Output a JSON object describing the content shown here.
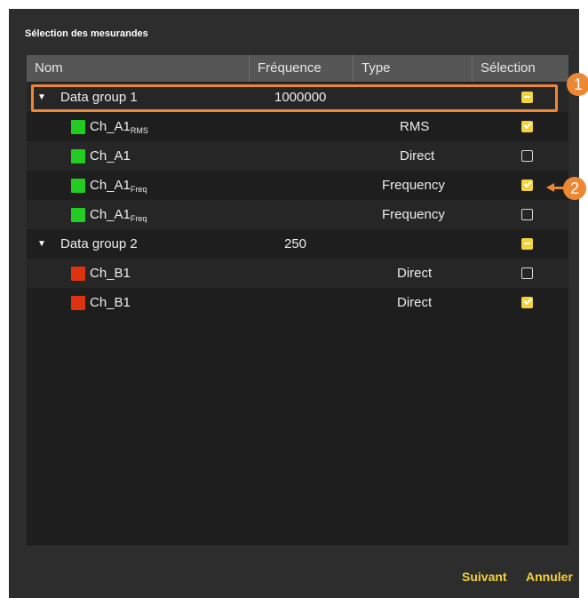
{
  "dialog": {
    "title": "Sélection des mesurandes"
  },
  "table": {
    "headers": {
      "name": "Nom",
      "frequency": "Fréquence",
      "type": "Type",
      "selection": "Sélection"
    },
    "groups": [
      {
        "name": "Data group 1",
        "frequency": "1000000",
        "selection": "partial",
        "channels": [
          {
            "base": "Ch_A1",
            "sub": "RMS",
            "type": "RMS",
            "color": "#22cc22",
            "selected": true
          },
          {
            "base": "Ch_A1",
            "sub": "",
            "type": "Direct",
            "color": "#22cc22",
            "selected": false
          },
          {
            "base": "Ch_A1",
            "sub": "Freq",
            "type": "Frequency",
            "color": "#22cc22",
            "selected": true
          },
          {
            "base": "Ch_A1",
            "sub": "Freq",
            "type": "Frequency",
            "color": "#22cc22",
            "selected": false
          }
        ]
      },
      {
        "name": "Data group 2",
        "frequency": "250",
        "selection": "partial",
        "channels": [
          {
            "base": "Ch_B1",
            "sub": "",
            "type": "Direct",
            "color": "#dd3311",
            "selected": false
          },
          {
            "base": "Ch_B1",
            "sub": "",
            "type": "Direct",
            "color": "#dd3311",
            "selected": true
          }
        ]
      }
    ]
  },
  "callouts": {
    "one": "1",
    "two": "2",
    "color": "#ee8733"
  },
  "footer": {
    "next_label": "Suivant",
    "cancel_label": "Annuler",
    "accent": "#f3d23a"
  }
}
